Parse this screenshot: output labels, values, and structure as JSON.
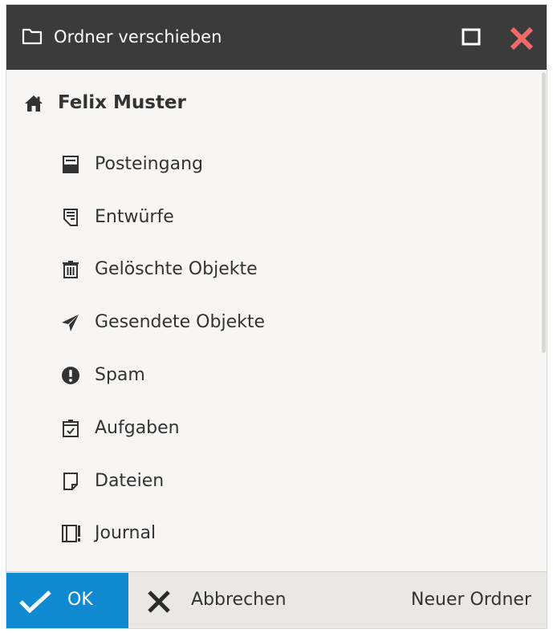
{
  "dialog": {
    "title": "Ordner verschieben",
    "icon": "folder-outline-icon",
    "controls": {
      "maximize_icon": "maximize-icon",
      "close_icon": "close-icon",
      "close_color": "#f06a6a"
    }
  },
  "tree": {
    "root": {
      "label": "Felix Muster",
      "icon": "home-icon"
    },
    "folders": [
      {
        "label": "Posteingang",
        "icon": "inbox-icon"
      },
      {
        "label": "Entwürfe",
        "icon": "drafts-icon"
      },
      {
        "label": "Gelöschte Objekte",
        "icon": "trash-icon"
      },
      {
        "label": "Gesendete Objekte",
        "icon": "paper-plane-icon"
      },
      {
        "label": "Spam",
        "icon": "exclamation-icon"
      },
      {
        "label": "Aufgaben",
        "icon": "tasks-icon"
      },
      {
        "label": "Dateien",
        "icon": "file-icon"
      },
      {
        "label": "Journal",
        "icon": "journal-icon"
      }
    ]
  },
  "footer": {
    "ok_label": "OK",
    "cancel_label": "Abbrechen",
    "new_folder_label": "Neuer Ordner"
  },
  "colors": {
    "titlebar": "#3b3b3b",
    "accent": "#0f8ad0",
    "body_bg": "#f7f6f4",
    "footer_bg": "#eae8e5"
  }
}
